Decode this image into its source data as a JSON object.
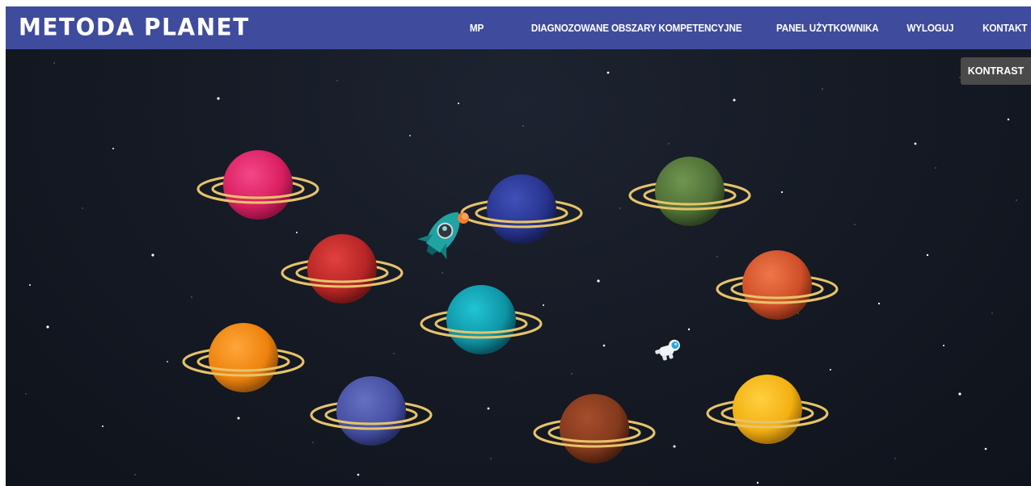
{
  "brand": {
    "title": "METODA PLANET"
  },
  "nav": {
    "items": [
      "MP",
      "DIAGNOZOWANE OBSZARY KOMPETENCYJNE",
      "PANEL UŻYTKOWNIKA",
      "WYLOGUJ",
      "KONTAKT"
    ]
  },
  "contrast": {
    "label": "KONTRAST"
  },
  "colors": {
    "navbar": "#3f4c9d",
    "space": "#141923",
    "ring": "#e6c36a",
    "contrast_button": "#4a4a4a"
  },
  "planets": [
    {
      "name": "planet-magenta",
      "color": "#e62a6a"
    },
    {
      "name": "planet-navy",
      "color": "#2f3b9a"
    },
    {
      "name": "planet-green",
      "color": "#55783a"
    },
    {
      "name": "planet-red",
      "color": "#c22b2b"
    },
    {
      "name": "planet-coral",
      "color": "#d8552a"
    },
    {
      "name": "planet-teal",
      "color": "#0f9fb0"
    },
    {
      "name": "planet-orange",
      "color": "#f0870f"
    },
    {
      "name": "planet-indigo",
      "color": "#4a55a8"
    },
    {
      "name": "planet-brown",
      "color": "#8a3c1f"
    },
    {
      "name": "planet-yellow",
      "color": "#f5b514"
    }
  ],
  "icons": [
    "rocket-icon",
    "astronaut-icon"
  ]
}
